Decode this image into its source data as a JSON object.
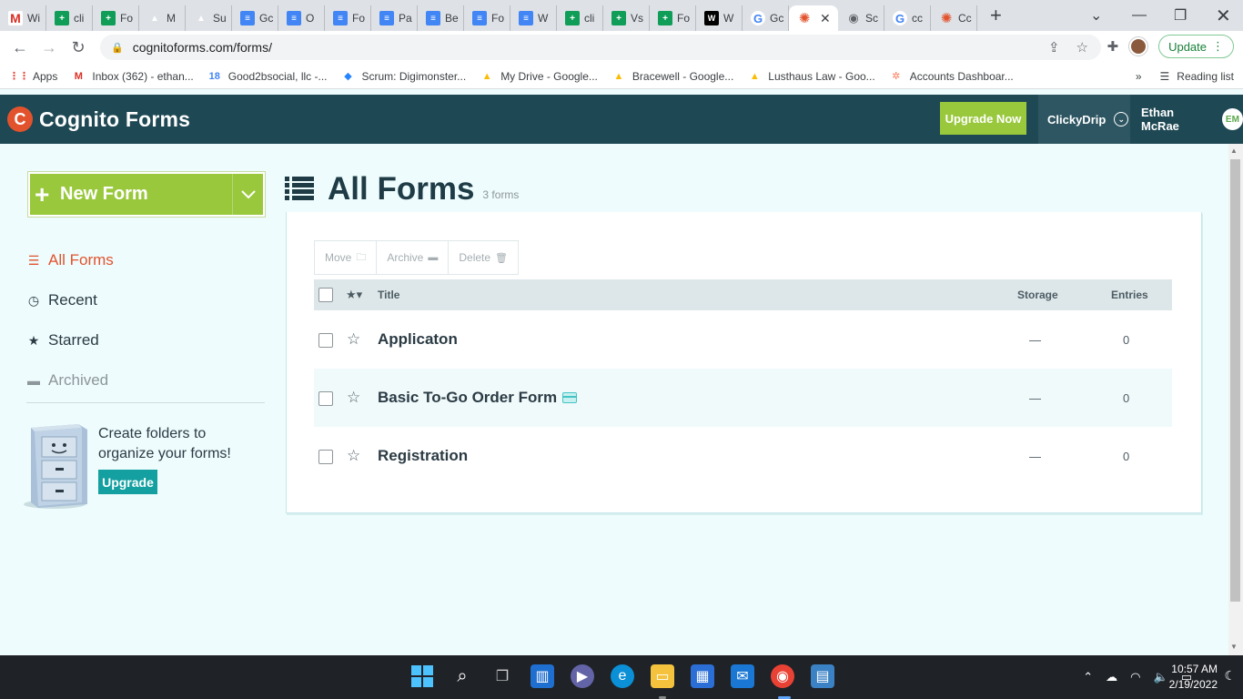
{
  "browser": {
    "tabs": [
      {
        "label": "Wi",
        "icon": "gmail-icon",
        "glyph": "M",
        "cls": "gmail"
      },
      {
        "label": "cli",
        "icon": "sheets-icon",
        "glyph": "+",
        "cls": "sheets"
      },
      {
        "label": "Fo",
        "icon": "sheets-icon",
        "glyph": "+",
        "cls": "sheets"
      },
      {
        "label": "M",
        "icon": "drive-icon",
        "glyph": "▲",
        "cls": "drive"
      },
      {
        "label": "Su",
        "icon": "drive-icon",
        "glyph": "▲",
        "cls": "drive"
      },
      {
        "label": "Gc",
        "icon": "docs-icon",
        "glyph": "≡",
        "cls": "docs"
      },
      {
        "label": "O",
        "icon": "docs-icon",
        "glyph": "≡",
        "cls": "docs"
      },
      {
        "label": "Fo",
        "icon": "docs-icon",
        "glyph": "≡",
        "cls": "docs"
      },
      {
        "label": "Pa",
        "icon": "docs-icon",
        "glyph": "≡",
        "cls": "docs"
      },
      {
        "label": "Be",
        "icon": "docs-icon",
        "glyph": "≡",
        "cls": "docs"
      },
      {
        "label": "Fo",
        "icon": "docs-icon",
        "glyph": "≡",
        "cls": "docs"
      },
      {
        "label": "W",
        "icon": "docs-icon",
        "glyph": "≡",
        "cls": "docs"
      },
      {
        "label": "cli",
        "icon": "sheets-icon",
        "glyph": "+",
        "cls": "sheets"
      },
      {
        "label": "Vs",
        "icon": "sheets-icon",
        "glyph": "+",
        "cls": "sheets"
      },
      {
        "label": "Fo",
        "icon": "sheets-icon",
        "glyph": "+",
        "cls": "sheets"
      },
      {
        "label": "W",
        "icon": "wix-icon",
        "glyph": "W",
        "cls": "wix"
      },
      {
        "label": "Gc",
        "icon": "google-icon",
        "glyph": "G",
        "cls": "google"
      },
      {
        "label": "",
        "icon": "cognito-icon",
        "glyph": "✺",
        "cls": "cog",
        "active": true
      },
      {
        "label": "Sc",
        "icon": "camera-icon",
        "glyph": "◉",
        "cls": "cam"
      },
      {
        "label": "cc",
        "icon": "google-icon",
        "glyph": "G",
        "cls": "google"
      },
      {
        "label": "Cc",
        "icon": "cognito-icon",
        "glyph": "✺",
        "cls": "cog"
      }
    ],
    "url": "cognitoforms.com/forms/",
    "update_label": "Update",
    "bookmarks": [
      {
        "label": "Apps",
        "icon": "apps-grid-icon",
        "glyph": "⋮⋮",
        "color": "#ea4335"
      },
      {
        "label": "Inbox (362) - ethan...",
        "icon": "gmail-icon",
        "glyph": "M",
        "color": "#d93025"
      },
      {
        "label": "Good2bsocial, llc -...",
        "icon": "calendar-icon",
        "glyph": "18",
        "color": "#4285f4"
      },
      {
        "label": "Scrum: Digimonster...",
        "icon": "jira-icon",
        "glyph": "◆",
        "color": "#2684ff"
      },
      {
        "label": "My Drive - Google...",
        "icon": "drive-icon",
        "glyph": "▲",
        "color": "#fbbc04"
      },
      {
        "label": "Bracewell - Google...",
        "icon": "drive-icon",
        "glyph": "▲",
        "color": "#fbbc04"
      },
      {
        "label": "Lusthaus Law - Goo...",
        "icon": "drive-icon",
        "glyph": "▲",
        "color": "#fbbc04"
      },
      {
        "label": "Accounts Dashboar...",
        "icon": "hubspot-icon",
        "glyph": "✲",
        "color": "#ff7a59"
      }
    ],
    "reading_list": "Reading list",
    "more_bookmarks": "»"
  },
  "app": {
    "logo_text": "Cognito Forms",
    "logo_letter": "C",
    "upgrade_now": "Upgrade Now",
    "org_name": "ClickyDrip",
    "user_name": "Ethan McRae",
    "user_initials": "EM"
  },
  "sidebar": {
    "new_form": "New Form",
    "nav": [
      {
        "label": "All Forms",
        "icon": "list-icon",
        "glyph": "☰",
        "state": "active"
      },
      {
        "label": "Recent",
        "icon": "clock-icon",
        "glyph": "◷",
        "state": ""
      },
      {
        "label": "Starred",
        "icon": "star-icon",
        "glyph": "★",
        "state": ""
      },
      {
        "label": "Archived",
        "icon": "archive-icon",
        "glyph": "▬",
        "state": "muted"
      }
    ],
    "promo_text": "Create folders to organize your forms!",
    "promo_button": "Upgrade"
  },
  "main": {
    "title": "All Forms",
    "count": "3 forms",
    "bulk": [
      {
        "label": "Move",
        "icon": "folder-icon",
        "glyph": "🗀"
      },
      {
        "label": "Archive",
        "icon": "archive-icon",
        "glyph": "▬"
      },
      {
        "label": "Delete",
        "icon": "trash-icon",
        "glyph": "🗑"
      }
    ],
    "columns": {
      "title": "Title",
      "storage": "Storage",
      "entries": "Entries"
    },
    "rows": [
      {
        "title": "Applicaton",
        "storage": "—",
        "entries": "0",
        "payment": false
      },
      {
        "title": "Basic To-Go Order Form",
        "storage": "—",
        "entries": "0",
        "payment": true
      },
      {
        "title": "Registration",
        "storage": "—",
        "entries": "0",
        "payment": false
      }
    ]
  },
  "taskbar": {
    "time": "10:57 AM",
    "date": "2/19/2022"
  },
  "colors": {
    "header": "#1e4854",
    "accent_green": "#99c83c",
    "accent_orange": "#e2532d",
    "teal": "#14a0a0",
    "page_bg": "#eefcfd"
  }
}
